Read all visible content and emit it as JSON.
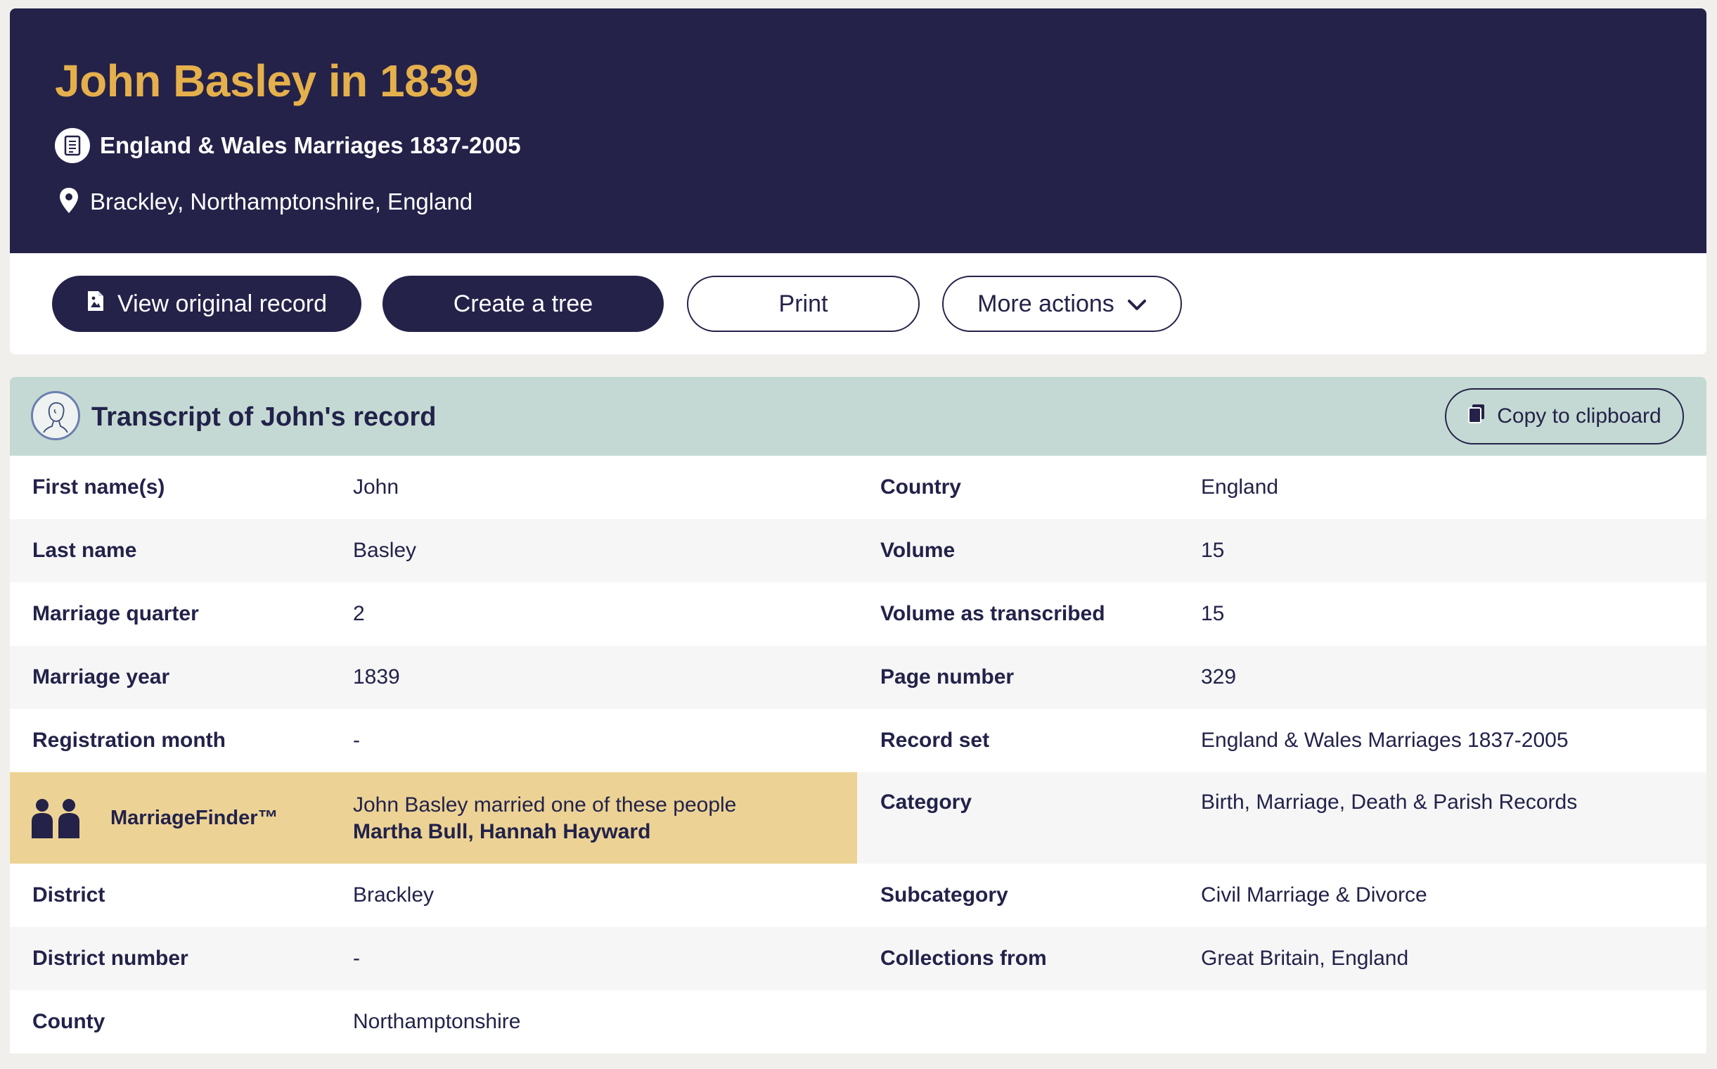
{
  "header": {
    "title": "John Basley in 1839",
    "collection": "England & Wales Marriages 1837-2005",
    "location": "Brackley, Northamptonshire, England",
    "icons": {
      "collection": "document-icon",
      "location": "map-pin-icon"
    }
  },
  "actions": {
    "view_original": "View original record",
    "create_tree": "Create a tree",
    "print": "Print",
    "more_actions": "More actions"
  },
  "transcript": {
    "title": "Transcript of John's record",
    "copy_button": "Copy to clipboard"
  },
  "rows": [
    {
      "l1": "First name(s)",
      "v1": "John",
      "l2": "Country",
      "v2": "England"
    },
    {
      "l1": "Last name",
      "v1": "Basley",
      "l2": "Volume",
      "v2": "15"
    },
    {
      "l1": "Marriage quarter",
      "v1": "2",
      "l2": "Volume as transcribed",
      "v2": "15"
    },
    {
      "l1": "Marriage year",
      "v1": "1839",
      "l2": "Page number",
      "v2": "329"
    },
    {
      "l1": "Registration month",
      "v1": "-",
      "l2": "Record set",
      "v2": "England & Wales Marriages 1837-2005"
    },
    {
      "l1": "MarriageFinder™",
      "v1": "John Basley married one of these people",
      "v1b": "Martha Bull, Hannah Hayward",
      "l2": "Category",
      "v2": "Birth, Marriage, Death & Parish Records"
    },
    {
      "l1": "District",
      "v1": "Brackley",
      "l2": "Subcategory",
      "v2": "Civil Marriage & Divorce"
    },
    {
      "l1": "District number",
      "v1": "-",
      "l2": "Collections from",
      "v2": "Great Britain, England"
    },
    {
      "l1": "County",
      "v1": "Northamptonshire",
      "l2": "",
      "v2": ""
    }
  ],
  "colors": {
    "navy": "#242249",
    "gold_title": "#e5b04c",
    "teal_header": "#c4d9d3",
    "marriagefinder_bg": "#ecd395"
  }
}
